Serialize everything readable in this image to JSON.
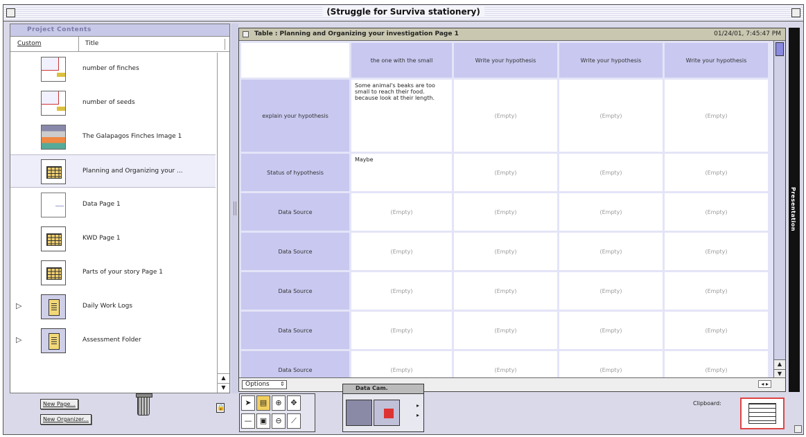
{
  "window": {
    "title": "(Struggle for Surviva stationery)"
  },
  "project": {
    "header": "Project Contents",
    "col_custom": "Custom",
    "col_title": "Title",
    "items": [
      {
        "label": "number of finches",
        "icon": "page-thumbnail-icon"
      },
      {
        "label": "number of seeds",
        "icon": "page-thumbnail-icon"
      },
      {
        "label": "The Galapagos Finches Image 1",
        "icon": "image-thumbnail-icon"
      },
      {
        "label": "Planning and Organizing your ...",
        "icon": "table-icon"
      },
      {
        "label": "Data Page 1",
        "icon": "data-page-icon"
      },
      {
        "label": "KWD Page 1",
        "icon": "table-icon"
      },
      {
        "label": "Parts of your story Page 1",
        "icon": "table-icon"
      },
      {
        "label": "Daily Work Logs",
        "icon": "folder-icon"
      },
      {
        "label": "Assessment Folder",
        "icon": "folder-icon"
      }
    ],
    "new_page": "New Page...",
    "new_organizer": "New Organizer..."
  },
  "table": {
    "title": "Table : Planning and Organizing your investigation Page 1",
    "date": "01/24/01, 7:45:47 PM",
    "columns": [
      "the one with the small",
      "Write your hypothesis",
      "Write your hypothesis",
      "Write your hypothesis"
    ],
    "rows": [
      {
        "header": "explain your hypothesis",
        "cells": [
          "Some animal's beaks are too small to reach their food. because look at their length.",
          "(Empty)",
          "(Empty)",
          "(Empty)"
        ]
      },
      {
        "header": "Status of hypothesis",
        "cells": [
          "Maybe",
          "(Empty)",
          "(Empty)",
          "(Empty)"
        ]
      },
      {
        "header": "Data Source",
        "cells": [
          "(Empty)",
          "(Empty)",
          "(Empty)",
          "(Empty)"
        ]
      },
      {
        "header": "Data Source",
        "cells": [
          "(Empty)",
          "(Empty)",
          "(Empty)",
          "(Empty)"
        ]
      },
      {
        "header": "Data Source",
        "cells": [
          "(Empty)",
          "(Empty)",
          "(Empty)",
          "(Empty)"
        ]
      },
      {
        "header": "Data Source",
        "cells": [
          "(Empty)",
          "(Empty)",
          "(Empty)",
          "(Empty)"
        ]
      },
      {
        "header": "Data Source",
        "cells": [
          "(Empty)",
          "(Empty)",
          "(Empty)",
          "(Empty)"
        ]
      }
    ],
    "options": "Options",
    "side_tab": "Presentation"
  },
  "datacam": {
    "title": "Data Cam."
  },
  "clipboard": {
    "label": "Clipboard:"
  }
}
